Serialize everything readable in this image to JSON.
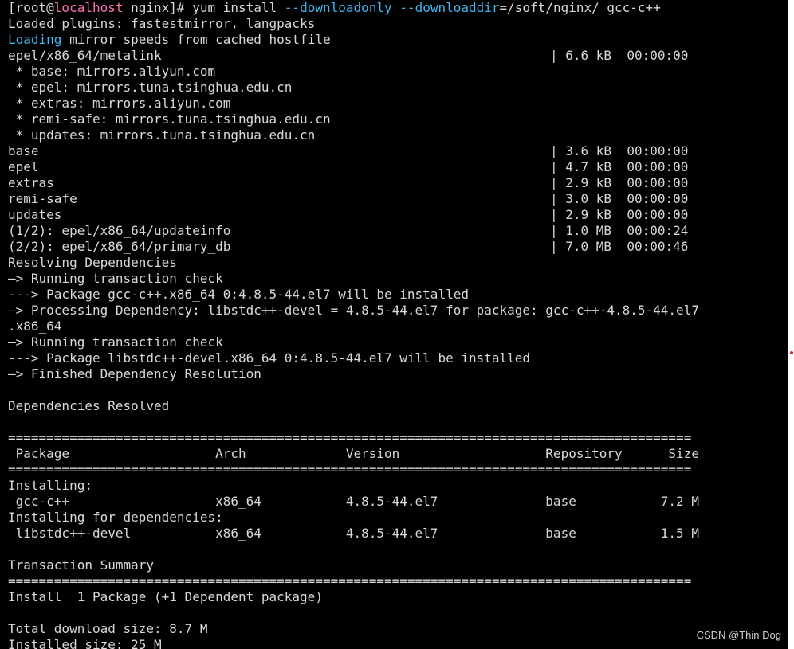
{
  "terminal": {
    "prompt": {
      "open": "[root@",
      "host": "localhost",
      "path": " nginx]# ",
      "cmd": "yum install ",
      "flag1": "--downloadonly",
      "sp": " ",
      "flag2": "--downloaddir",
      "rest": "=/soft/nginx/ gcc-c++"
    },
    "loaded_plugins": "Loaded plugins: fastestmirror, langpacks",
    "loading": {
      "word": "Loading",
      "rest": " mirror speeds from cached hostfile"
    },
    "metalink": {
      "left": "epel/x86_64/metalink",
      "right": "| 6.6 kB  00:00:00"
    },
    "mirrors": [
      " * base: mirrors.aliyun.com",
      " * epel: mirrors.tuna.tsinghua.edu.cn",
      " * extras: mirrors.aliyun.com",
      " * remi-safe: mirrors.tuna.tsinghua.edu.cn",
      " * updates: mirrors.tuna.tsinghua.edu.cn"
    ],
    "repos": [
      {
        "left": "base",
        "right": "| 3.6 kB  00:00:00"
      },
      {
        "left": "epel",
        "right": "| 4.7 kB  00:00:00"
      },
      {
        "left": "extras",
        "right": "| 2.9 kB  00:00:00"
      },
      {
        "left": "remi-safe",
        "right": "| 3.0 kB  00:00:00"
      },
      {
        "left": "updates",
        "right": "| 2.9 kB  00:00:00"
      },
      {
        "left": "(1/2): epel/x86_64/updateinfo",
        "right": "| 1.0 MB  00:00:24"
      },
      {
        "left": "(2/2): epel/x86_64/primary_db",
        "right": "| 7.0 MB  00:00:46"
      }
    ],
    "resolution": [
      "Resolving Dependencies",
      "—> Running transaction check",
      "---> Package gcc-c++.x86_64 0:4.8.5-44.el7 will be installed",
      "—> Processing Dependency: libstdc++-devel = 4.8.5-44.el7 for package: gcc-c++-4.8.5-44.el7",
      ".x86_64",
      "—> Running transaction check",
      "---> Package libstdc++-devel.x86_64 0:4.8.5-44.el7 will be installed",
      "—> Finished Dependency Resolution"
    ],
    "deps_resolved": "Dependencies Resolved",
    "separator": "=========================================================================================",
    "table": {
      "header": " Package                   Arch             Version                   Repository      Size",
      "installing": "Installing:",
      "row1": " gcc-c++                   x86_64           4.8.5-44.el7              base           7.2 M",
      "installing_deps": "Installing for dependencies:",
      "row2": " libstdc++-devel           x86_64           4.8.5-44.el7              base           1.5 M"
    },
    "summary_title": "Transaction Summary",
    "install_line": "Install  1 Package (+1 Dependent package)",
    "total_download": "Total download size: 8.7 M",
    "installed_size": "Installed size: 25 M"
  },
  "watermark": "CSDN @Thin Dog",
  "colors": {
    "background": "#000000",
    "text": "#d8d8d8",
    "host": "#ff6fb0",
    "flags": "#3fb7f0"
  }
}
